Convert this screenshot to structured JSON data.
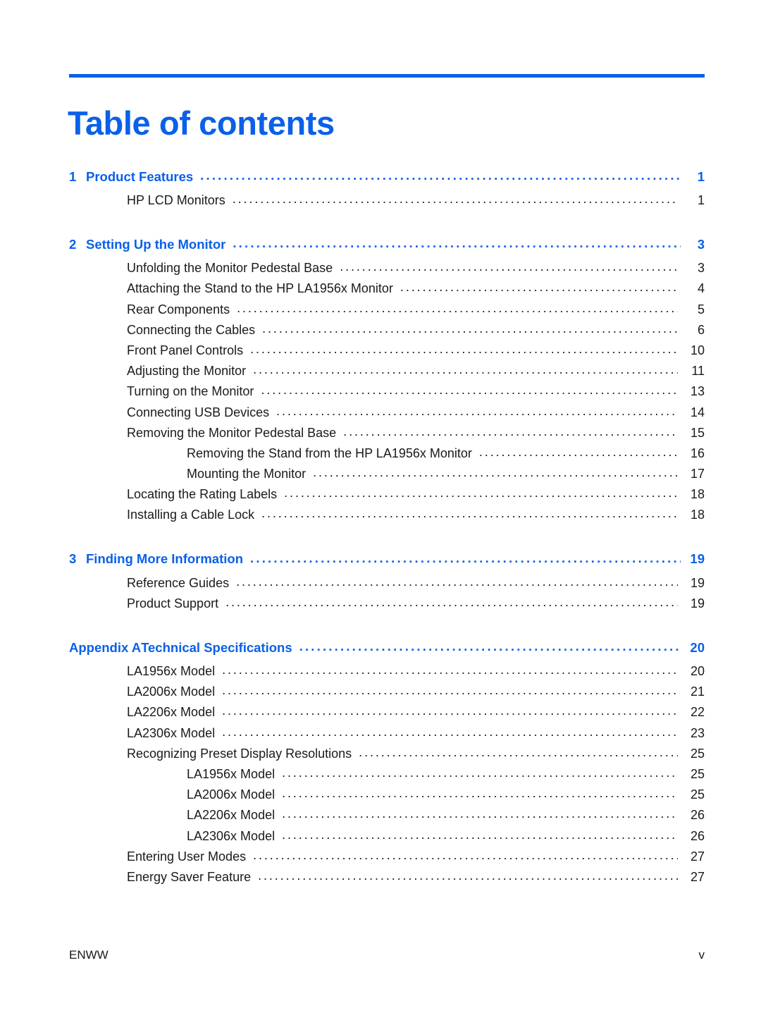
{
  "document": {
    "title": "Table of contents",
    "accent_color": "#0a60e8",
    "text_color": "#1a1a1a"
  },
  "footer": {
    "left": "ENWW",
    "right": "v"
  },
  "toc": {
    "entries": [
      {
        "level": 0,
        "number": "1",
        "label": "Product Features",
        "page": "1"
      },
      {
        "level": 1,
        "number": "",
        "label": "HP LCD Monitors",
        "page": "1"
      },
      {
        "level": 0,
        "number": "2",
        "label": "Setting Up the Monitor",
        "page": "3"
      },
      {
        "level": 1,
        "number": "",
        "label": "Unfolding the Monitor Pedestal Base",
        "page": "3"
      },
      {
        "level": 1,
        "number": "",
        "label": "Attaching the Stand to the HP LA1956x Monitor",
        "page": "4"
      },
      {
        "level": 1,
        "number": "",
        "label": "Rear Components",
        "page": "5"
      },
      {
        "level": 1,
        "number": "",
        "label": "Connecting the Cables",
        "page": "6"
      },
      {
        "level": 1,
        "number": "",
        "label": "Front Panel Controls",
        "page": "10"
      },
      {
        "level": 1,
        "number": "",
        "label": "Adjusting the Monitor",
        "page": "11"
      },
      {
        "level": 1,
        "number": "",
        "label": "Turning on the Monitor",
        "page": "13"
      },
      {
        "level": 1,
        "number": "",
        "label": "Connecting USB Devices",
        "page": "14"
      },
      {
        "level": 1,
        "number": "",
        "label": "Removing the Monitor Pedestal Base",
        "page": "15"
      },
      {
        "level": 2,
        "number": "",
        "label": "Removing the Stand from the HP LA1956x Monitor",
        "page": "16"
      },
      {
        "level": 2,
        "number": "",
        "label": "Mounting the Monitor",
        "page": "17"
      },
      {
        "level": 1,
        "number": "",
        "label": "Locating the Rating Labels",
        "page": "18"
      },
      {
        "level": 1,
        "number": "",
        "label": "Installing a Cable Lock",
        "page": "18"
      },
      {
        "level": 0,
        "number": "3",
        "label": "Finding More Information",
        "page": "19"
      },
      {
        "level": 1,
        "number": "",
        "label": "Reference Guides",
        "page": "19"
      },
      {
        "level": 1,
        "number": "",
        "label": "Product Support",
        "page": "19"
      },
      {
        "level": 0,
        "number": "Appendix A",
        "label": "Technical Specifications",
        "page": "20"
      },
      {
        "level": 1,
        "number": "",
        "label": "LA1956x Model",
        "page": "20"
      },
      {
        "level": 1,
        "number": "",
        "label": "LA2006x Model",
        "page": "21"
      },
      {
        "level": 1,
        "number": "",
        "label": "LA2206x Model",
        "page": "22"
      },
      {
        "level": 1,
        "number": "",
        "label": "LA2306x Model",
        "page": "23"
      },
      {
        "level": 1,
        "number": "",
        "label": "Recognizing Preset Display Resolutions",
        "page": "25"
      },
      {
        "level": 2,
        "number": "",
        "label": "LA1956x Model",
        "page": "25"
      },
      {
        "level": 2,
        "number": "",
        "label": "LA2006x Model",
        "page": "25"
      },
      {
        "level": 2,
        "number": "",
        "label": "LA2206x Model",
        "page": "26"
      },
      {
        "level": 2,
        "number": "",
        "label": "LA2306x Model",
        "page": "26"
      },
      {
        "level": 1,
        "number": "",
        "label": "Entering User Modes",
        "page": "27"
      },
      {
        "level": 1,
        "number": "",
        "label": "Energy Saver Feature",
        "page": "27"
      }
    ]
  }
}
